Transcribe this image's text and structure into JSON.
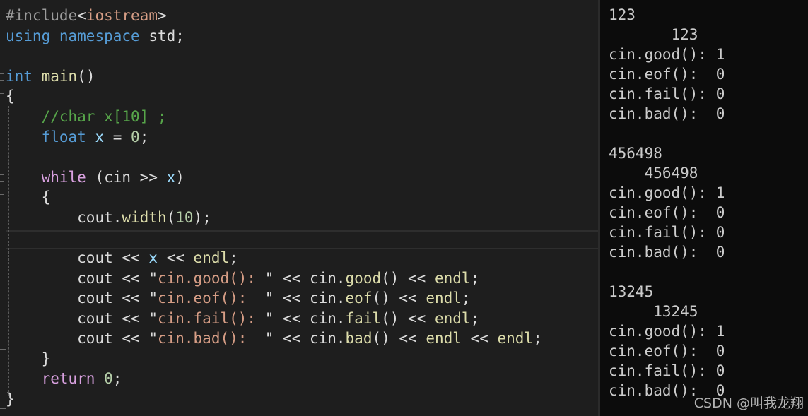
{
  "editor": {
    "code_lines": [
      "#include<iostream>",
      "using namespace std;",
      "",
      "int main()",
      "{",
      "    //char x[10] ;",
      "    float x = 0;",
      "",
      "    while (cin >> x)",
      "    {",
      "        cout.width(10);",
      "",
      "        cout << x << endl;",
      "        cout << \"cin.good(): \" << cin.good() << endl;",
      "        cout << \"cin.eof():  \" << cin.eof() << endl;",
      "        cout << \"cin.fail(): \" << cin.fail() << endl;",
      "        cout << \"cin.bad():  \" << cin.bad() << endl << endl;",
      "    }",
      "    return 0;",
      "}"
    ]
  },
  "console": {
    "lines": [
      "123",
      "       123",
      "cin.good(): 1",
      "cin.eof():  0",
      "cin.fail(): 0",
      "cin.bad():  0",
      "",
      "456498",
      "    456498",
      "cin.good(): 1",
      "cin.eof():  0",
      "cin.fail(): 0",
      "cin.bad():  0",
      "",
      "13245",
      "     13245",
      "cin.good(): 1",
      "cin.eof():  0",
      "cin.fail(): 0",
      "cin.bad():  0"
    ]
  },
  "watermark": "CSDN @叫我龙翔",
  "colors": {
    "editor_bg": "#1e1e1e",
    "console_bg": "#0c0c0c",
    "keyword": "#569cd6",
    "control": "#d8a0df",
    "string": "#d69d85",
    "comment": "#57a64a",
    "number": "#b5cea8",
    "function": "#dcdcaa",
    "variable": "#9cdcfe"
  }
}
